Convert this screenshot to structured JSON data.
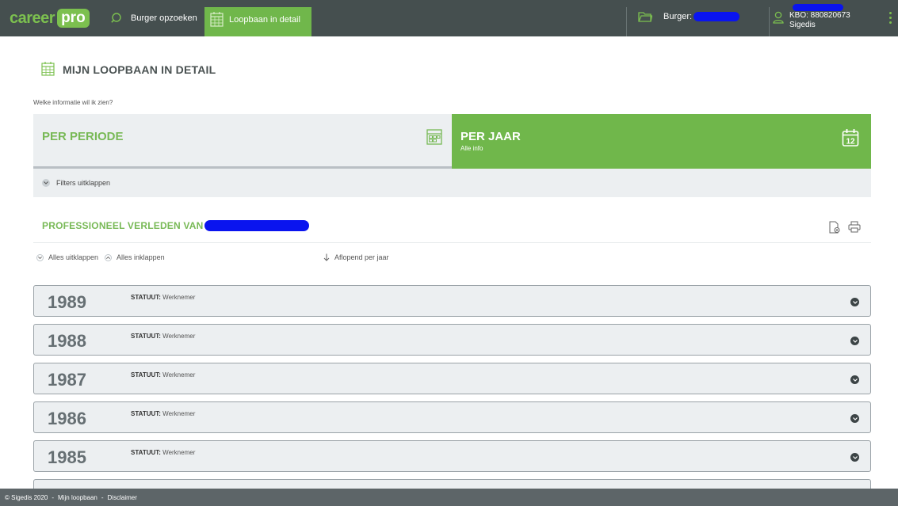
{
  "colors": {
    "green": "#70b74b",
    "topbar": "#454f4f",
    "redaction": "#0a14ef"
  },
  "header": {
    "logo_career": "career",
    "logo_pro": "pro",
    "nav_search": "Burger opzoeken",
    "nav_detail": "Loopbaan in detail",
    "burger_label": "Burger:",
    "kbo": "KBO: 880820673",
    "org": "Sigedis"
  },
  "page": {
    "title": "MIJN LOOPBAAN IN DETAIL",
    "question": "Welke informatie wil ik zien?"
  },
  "selector": {
    "per_periode": "PER PERIODE",
    "per_jaar": "PER JAAR",
    "per_jaar_sub": "Alle info",
    "calendar_day": "12"
  },
  "filters": {
    "label": "Filters uitklappen"
  },
  "professional": {
    "title": "PROFESSIONEEL VERLEDEN VAN",
    "expand_all": "Alles uitklappen",
    "collapse_all": "Alles inklappen",
    "sort": "Aflopend per jaar"
  },
  "years": [
    {
      "year": "1989",
      "status_label": "STATUUT:",
      "status_value": "Werknemer"
    },
    {
      "year": "1988",
      "status_label": "STATUUT:",
      "status_value": "Werknemer"
    },
    {
      "year": "1987",
      "status_label": "STATUUT:",
      "status_value": "Werknemer"
    },
    {
      "year": "1986",
      "status_label": "STATUUT:",
      "status_value": "Werknemer"
    },
    {
      "year": "1985",
      "status_label": "STATUUT:",
      "status_value": "Werknemer"
    }
  ],
  "footer": {
    "copyright": "© Sigedis 2020",
    "link1": "Mijn loopbaan",
    "link2": "Disclaimer",
    "separator": "-"
  }
}
